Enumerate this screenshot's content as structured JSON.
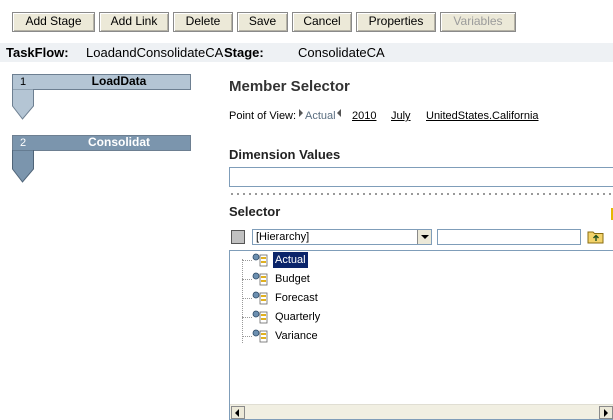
{
  "toolbar": {
    "buttons": [
      {
        "label": "Add Stage"
      },
      {
        "label": "Add Link"
      },
      {
        "label": "Delete"
      },
      {
        "label": "Save"
      },
      {
        "label": "Cancel"
      },
      {
        "label": "Properties"
      },
      {
        "label": "Variables",
        "disabled": true
      }
    ]
  },
  "header": {
    "taskflow_label": "TaskFlow:",
    "taskflow_value": "LoadandConsolidateCA",
    "stage_label": "Stage:",
    "stage_value": "ConsolidateCA"
  },
  "stages": [
    {
      "number": "1",
      "name": "LoadData",
      "active": false
    },
    {
      "number": "2",
      "name": "Consolidat",
      "active": true
    }
  ],
  "member_selector": {
    "title": "Member Selector",
    "pov": {
      "label": "Point of View:",
      "scenario": "Actual",
      "year": "2010",
      "period": "July",
      "entity": "UnitedStates.California"
    },
    "dimension_values_title": "Dimension Values",
    "dimension_values_value": "",
    "selector_title": "Selector",
    "hierarchy_select": {
      "selected": "[Hierarchy]"
    },
    "search_value": "",
    "tree_items": [
      {
        "label": "Actual",
        "selected": true
      },
      {
        "label": "Budget",
        "selected": false
      },
      {
        "label": "Forecast",
        "selected": false
      },
      {
        "label": "Quarterly",
        "selected": false
      },
      {
        "label": "Variance",
        "selected": false
      }
    ]
  },
  "colors": {
    "stage_inactive": "#b4c5d4",
    "stage_active": "#7b95ad",
    "header_bg": "#eef1f4",
    "selection": "#0a246a"
  },
  "icons": {
    "tree_member": "member-hierarchy-icon",
    "folder_up": "folder-up-icon"
  }
}
